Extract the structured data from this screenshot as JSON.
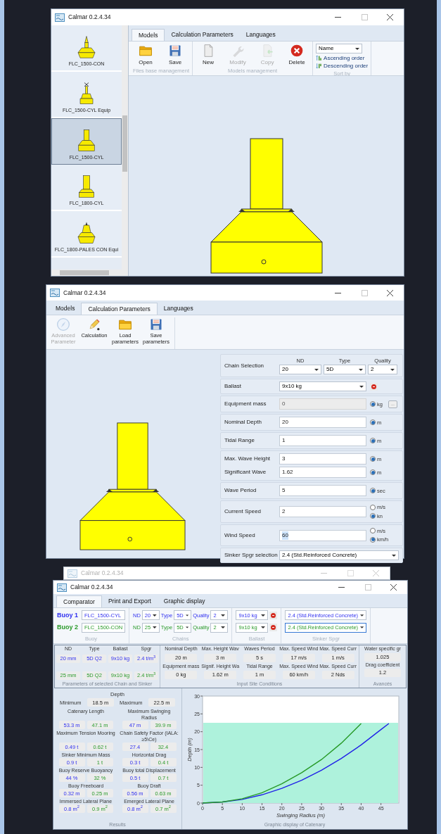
{
  "models_window": {
    "title": "Calmar 0.2.4.34",
    "model_list": [
      {
        "label": "FLC_1500-CON",
        "kind": "con",
        "selected": false
      },
      {
        "label": "FLC_1500-CYL Equip",
        "kind": "equip",
        "selected": false
      },
      {
        "label": "FLC_1500-CYL",
        "kind": "cyl",
        "selected": true
      },
      {
        "label": "FLC_1800-CYL",
        "kind": "tall",
        "selected": false
      },
      {
        "label": "FLC_1800-PALES CON Equi",
        "kind": "pales",
        "selected": false
      }
    ],
    "tabs": [
      {
        "label": "Models",
        "selected": true
      },
      {
        "label": "Calculation Parameters",
        "selected": false
      },
      {
        "label": "Languages",
        "selected": false
      }
    ],
    "ribbon_groups": [
      {
        "label": "Files base management",
        "buttons": [
          {
            "label": "Open",
            "kind": "folder",
            "disabled": false
          },
          {
            "label": "Save",
            "kind": "floppy",
            "disabled": false
          }
        ]
      },
      {
        "label": "Models management",
        "buttons": [
          {
            "label": "New",
            "kind": "new",
            "disabled": false
          },
          {
            "label": "Modify",
            "kind": "wrench",
            "disabled": true
          },
          {
            "label": "Copy",
            "kind": "copy",
            "disabled": true
          },
          {
            "label": "Delete",
            "kind": "delete",
            "disabled": false
          }
        ]
      }
    ],
    "sort_by": {
      "label": "Sort by",
      "select": "Name",
      "options": [
        {
          "label": "Ascending order",
          "kind": "asc"
        },
        {
          "label": "Descending order",
          "kind": "desc"
        }
      ]
    }
  },
  "parameters_window": {
    "title": "Calmar 0.2.4.34",
    "tabs": [
      {
        "label": "Models",
        "selected": false
      },
      {
        "label": "Calculation Parameters",
        "selected": true
      },
      {
        "label": "Languages",
        "selected": false
      }
    ],
    "toolbar": [
      {
        "label": "Advanced Parameter",
        "kind": "compass",
        "disabled": true
      },
      {
        "label": "Calculation",
        "kind": "pencil",
        "disabled": false
      },
      {
        "label": "Load parameters",
        "kind": "folder",
        "disabled": false
      },
      {
        "label": "Save parameters",
        "kind": "floppy",
        "disabled": false
      }
    ],
    "form_groups": [
      {
        "rows": [
          {
            "kind": "chain",
            "label": "Chain Selection",
            "selects": [
              {
                "header": "ND",
                "value": "20"
              },
              {
                "header": "Type",
                "value": "5D"
              },
              {
                "header": "Quality",
                "value": "2"
              }
            ]
          }
        ]
      },
      {
        "rows": [
          {
            "kind": "select",
            "label": "Ballast",
            "value": "9x10 kg",
            "delete": true
          }
        ]
      },
      {
        "rows": [
          {
            "kind": "input",
            "label": "Equipment mass",
            "value": "0",
            "disabled": true,
            "text_selected": false,
            "units": [
              {
                "label": "kg",
                "selected": true
              }
            ],
            "extra_button": "..."
          }
        ]
      },
      {
        "rows": [
          {
            "kind": "input",
            "label": "Nominal Depth",
            "value": "20",
            "disabled": false,
            "text_selected": false,
            "units": [
              {
                "label": "m",
                "selected": true
              }
            ]
          }
        ]
      },
      {
        "rows": [
          {
            "kind": "input",
            "label": "Tidal Range",
            "value": "1",
            "disabled": false,
            "text_selected": false,
            "units": [
              {
                "label": "m",
                "selected": true
              }
            ]
          }
        ]
      },
      {
        "rows": [
          {
            "kind": "input",
            "label": "Max. Wave Height",
            "value": "3",
            "disabled": false,
            "text_selected": false,
            "units": [
              {
                "label": "m",
                "selected": true
              }
            ]
          },
          {
            "kind": "input",
            "label": "Significant Wave",
            "value": "1.62",
            "disabled": false,
            "text_selected": false,
            "units": [
              {
                "label": "m",
                "selected": true
              }
            ]
          }
        ]
      },
      {
        "rows": [
          {
            "kind": "input",
            "label": "Wave Period",
            "value": "5",
            "disabled": false,
            "text_selected": false,
            "units": [
              {
                "label": "sec",
                "selected": true
              }
            ]
          }
        ]
      },
      {
        "rows": [
          {
            "kind": "input",
            "label": "Current Speed",
            "value": "2",
            "disabled": false,
            "text_selected": false,
            "units": [
              {
                "label": "m/s",
                "selected": false
              },
              {
                "label": "kn",
                "selected": true
              }
            ]
          }
        ]
      },
      {
        "rows": [
          {
            "kind": "input",
            "label": "Wind Speed",
            "value": "60",
            "disabled": false,
            "text_selected": true,
            "units": [
              {
                "label": "m/s",
                "selected": false
              },
              {
                "label": "km/h",
                "selected": true
              }
            ]
          }
        ]
      },
      {
        "rows": [
          {
            "kind": "select",
            "label": "Sinker Spgr selection",
            "value": "2.4 (Std.Reinforced Concrete)",
            "delete": false
          }
        ]
      }
    ]
  },
  "comparator_window": {
    "background_title": "Calmar 0.2.4.34",
    "title": "Calmar 0.2.4.34",
    "tabs": [
      {
        "label": "Comparator",
        "selected": true
      },
      {
        "label": "Print and Export",
        "selected": false
      },
      {
        "label": "Graphic display",
        "selected": false
      }
    ],
    "buoys": [
      {
        "label": "Buoy 1",
        "color": "#3030f0",
        "model": "FLC_1500-CYL",
        "chain": [
          {
            "label": "ND",
            "value": "20"
          },
          {
            "label": "Type",
            "value": "5D"
          },
          {
            "label": "Quality",
            "value": "2"
          }
        ],
        "ballast": "9x10 kg",
        "sinker": "2.4 (Std.Reinforced Concrete)",
        "sinker_focused": false
      },
      {
        "label": "Buoy 2",
        "color": "#2a9a2a",
        "model": "FLC_1500-CON",
        "chain": [
          {
            "label": "ND",
            "value": "25"
          },
          {
            "label": "Type",
            "value": "5D"
          },
          {
            "label": "Quality",
            "value": "2"
          }
        ],
        "ballast": "9x10 kg",
        "sinker": "2.4 (Std.Reinforced Concrete)",
        "sinker_focused": true
      }
    ],
    "selection_groups": [
      "Buoy",
      "Chains",
      "Ballast",
      "Sinker Spgr"
    ],
    "chain_sinker": {
      "columns": [
        "ND",
        "Type",
        "Ballast",
        "Spgr"
      ],
      "rows": [
        [
          "20 mm",
          "5D Q2",
          "9x10 kg",
          "2.4 t/m$^{3}$"
        ],
        [
          "25 mm",
          "5D Q2",
          "9x10 kg",
          "2.4 t/m$^{3}$"
        ]
      ],
      "caption": "Parameters of selected Chain and Sinker"
    },
    "site_conditions": {
      "rows": [
        {
          "headers": [
            "Nominal Depth",
            "Max. Height Wav",
            "Waves Period",
            "Max. Speed Wind",
            "Max. Speed Curr"
          ],
          "values": [
            "20 m",
            "3 m",
            "5 s",
            "17 m/s",
            "1 m/s"
          ]
        },
        {
          "headers": [
            "Equipment mass",
            "Signif. Height Wa",
            "Tidal Range",
            "Max. Speed Wind",
            "Max. Speed Curr"
          ],
          "values": [
            "0 kg",
            "1.62 m",
            "1 m",
            "60 km/h",
            "2 Nds"
          ]
        }
      ],
      "caption": "Input Site Conditions"
    },
    "advanced": {
      "rows": [
        {
          "header": "Water specific gr",
          "value": "1.025"
        },
        {
          "header": "Drag coefficient",
          "value": "1.2"
        }
      ],
      "caption": "Avancés"
    },
    "results": {
      "depth_title": "Depth",
      "depth": [
        {
          "label": "Minimum",
          "value": "18.5 m"
        },
        {
          "label": "Maximum",
          "value": "22.5 m"
        }
      ],
      "items": [
        {
          "label": "Catenary Length",
          "values": [
            "53.3 m",
            "47.1 m"
          ]
        },
        {
          "label": "Maximum Swinging Radius",
          "values": [
            "47 m",
            "39.9 m"
          ]
        },
        {
          "label": "Maximum Tension Mooring",
          "values": [
            "0.49 t",
            "0.62 t"
          ]
        },
        {
          "label": "Chain Safety Factor (IALA: ≥5\\Ce)",
          "values": [
            "27.4",
            "32.4"
          ]
        },
        {
          "label": "Sinker Minimum Mass",
          "values": [
            "0.9 t",
            "1 t"
          ]
        },
        {
          "label": "Horizontal Drag",
          "values": [
            "0.3 t",
            "0.4 t"
          ]
        },
        {
          "label": "Buoy Reserve Buoyancy",
          "values": [
            "44 %",
            "32 %"
          ]
        },
        {
          "label": "Buoy total Displacement",
          "values": [
            "0.5 t",
            "0.7 t"
          ]
        },
        {
          "label": "Buoy Freeboard",
          "values": [
            "0.32 m",
            "0.25 m"
          ]
        },
        {
          "label": "Buoy Draft",
          "values": [
            "0.56 m",
            "0.63 m"
          ]
        },
        {
          "label": "Immersed Lateral Plane",
          "values": [
            "0.8 m$^{2}$",
            "0.9 m$^{2}$"
          ]
        },
        {
          "label": "Emerged Lateral Plane",
          "values": [
            "0.8 m$^{2}$",
            "0.7 m$^{2}$"
          ]
        }
      ],
      "caption": "Results"
    },
    "catenary": {
      "caption": "Graphic display of Catenary",
      "chart_data": {
        "type": "line",
        "xlabel": "Swinging Radius (m)",
        "ylabel": "Depth (m)",
        "x": [
          0,
          5,
          10,
          15,
          20,
          25,
          30,
          35,
          40,
          45,
          47
        ],
        "series": [
          {
            "color": "#2020e8",
            "values": [
              0,
              0.3,
              1.0,
              2.3,
              4.1,
              6.4,
              9.2,
              12.5,
              16.3,
              20.6,
              22.3
            ]
          },
          {
            "color": "#279a27",
            "values": [
              0,
              0.3,
              1.2,
              2.9,
              5.4,
              8.5,
              12.2,
              16.8,
              22.3,
              null,
              null
            ]
          }
        ],
        "xlim": [
          0,
          49.5
        ],
        "ylim": [
          0,
          30
        ],
        "xticks": [
          0,
          5,
          10,
          15,
          20,
          25,
          30,
          35,
          40,
          45
        ],
        "yticks": [
          0,
          5,
          10,
          15,
          20,
          25,
          30
        ],
        "bands": [
          {
            "axis": "y",
            "from": 0,
            "to": 22.5,
            "color": "#aef2dc"
          }
        ]
      }
    }
  }
}
